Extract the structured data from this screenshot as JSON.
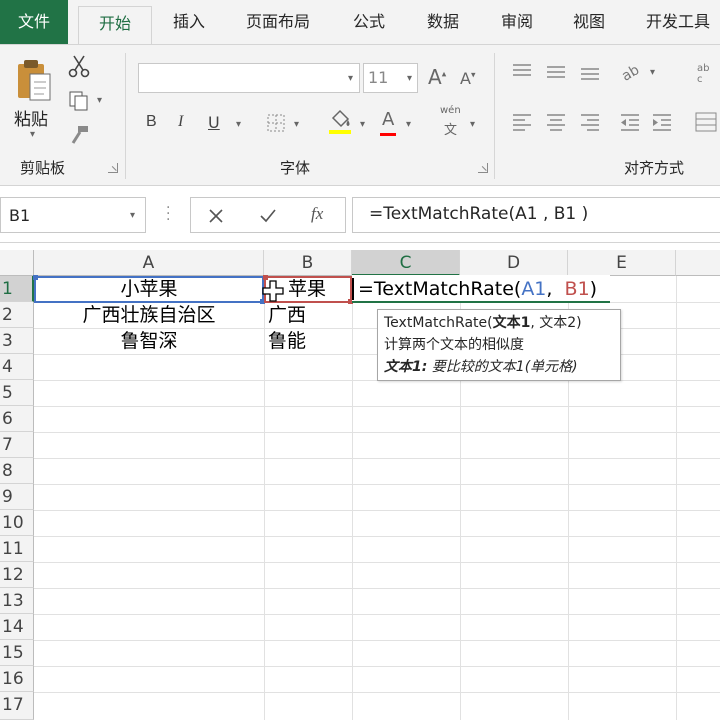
{
  "ribbon_tabs": [
    {
      "label": "文件"
    },
    {
      "label": "开始"
    },
    {
      "label": "插入"
    },
    {
      "label": "页面布局"
    },
    {
      "label": "公式"
    },
    {
      "label": "数据"
    },
    {
      "label": "审阅"
    },
    {
      "label": "视图"
    },
    {
      "label": "开发工具"
    }
  ],
  "clipboard": {
    "paste_label": "粘贴",
    "group_label": "剪贴板"
  },
  "font": {
    "font_name": "",
    "font_size": "11",
    "bold": "B",
    "italic": "I",
    "underline": "U",
    "color_glyph": "A",
    "wen_label": "wén",
    "wen_char": "文",
    "grow": "A",
    "shrink": "A",
    "group_label": "字体"
  },
  "alignment": {
    "group_label": "对齐方式"
  },
  "formula_bar": {
    "name_box": "B1",
    "fx": "fx",
    "formula": "=TextMatchRate(A1 , B1 )"
  },
  "columns": [
    "A",
    "B",
    "C",
    "D",
    "E"
  ],
  "rows": [
    "1",
    "2",
    "3",
    "4",
    "5",
    "6",
    "7",
    "8",
    "9",
    "10",
    "11",
    "12",
    "13",
    "14",
    "15",
    "16",
    "17"
  ],
  "cells": {
    "A1": "小苹果",
    "A2": "广西壮族自治区",
    "A3": "鲁智深",
    "B1": "苹果",
    "B2": "广西",
    "B3": "鲁能"
  },
  "edit_formula": {
    "prefix": "=TextMatchRate(",
    "ref1": "A1",
    "sep": ",  ",
    "ref2": "B1",
    "suffix": ")"
  },
  "tooltip": {
    "sig_name": "TextMatchRate(",
    "sig_arg1": "文本1",
    "sig_rest": ", 文本2)",
    "description": "计算两个文本的相似度",
    "arg_name": "文本1:",
    "arg_desc": " 要比较的文本1(单元格)"
  },
  "colors": {
    "excel_green": "#217346",
    "ref_blue": "#4472c4",
    "ref_red": "#c0504d"
  }
}
